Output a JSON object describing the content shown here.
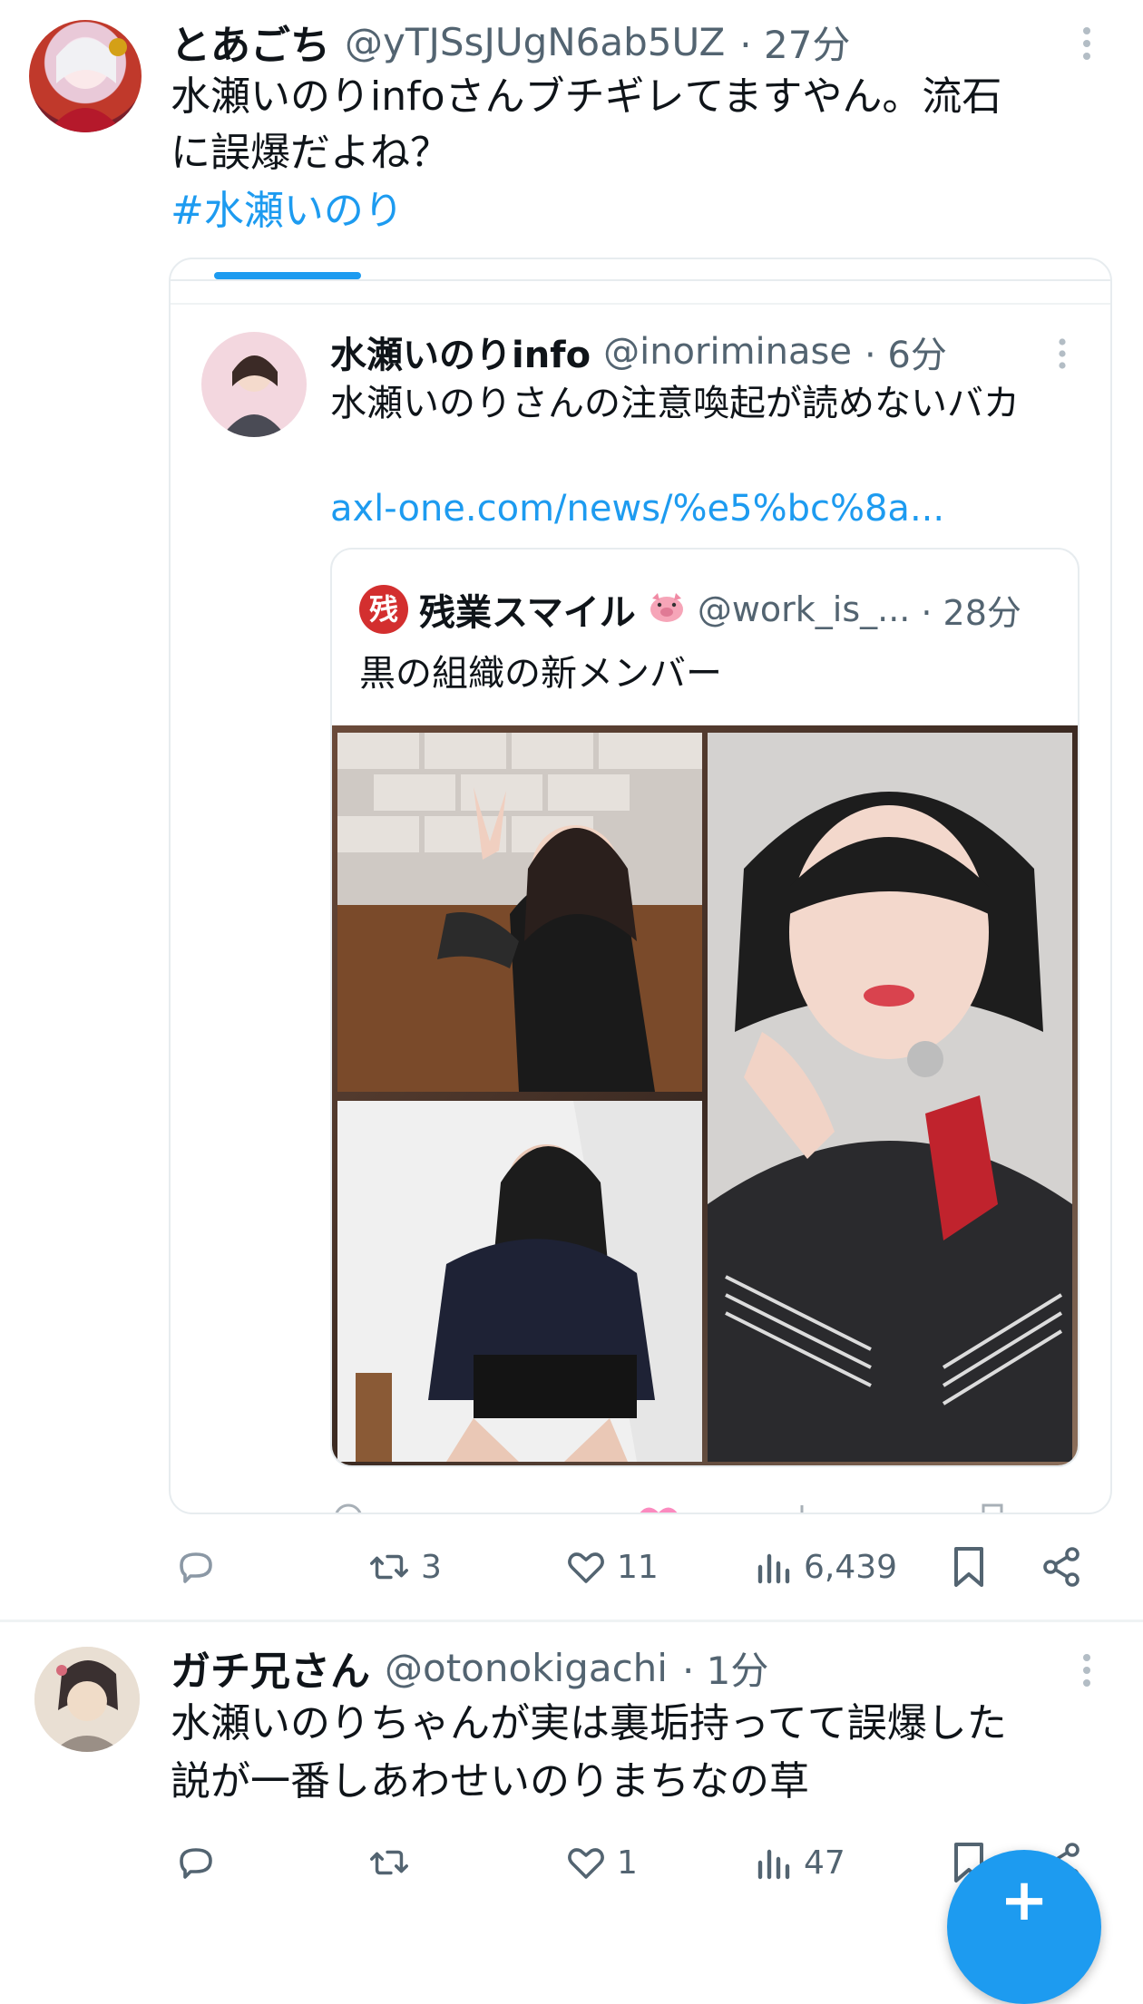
{
  "tweet1": {
    "display_name": "とあごち",
    "handle": "@yTJSsJUgN6ab5UZ",
    "time": "· 27分",
    "line1": "水瀬いのりinfoさんブチギレてますやん。流石",
    "line2": "に誤爆だよね？",
    "hashtag": "#水瀬いのり",
    "actions": {
      "retweets": "3",
      "likes": "11",
      "views": "6,439"
    }
  },
  "quoted": {
    "display_name": "水瀬いのりinfo",
    "handle": "@inoriminase",
    "time": "· 6分",
    "text": "水瀬いのりさんの注意喚起が読めないバカ",
    "url": "axl-one.com/news/%e5%bc%8a...",
    "inner": {
      "badge": "残",
      "display_name": "残業スマイル",
      "handle": "@work_is_...",
      "time": "· 28分",
      "text": "黒の組織の新メンバー"
    }
  },
  "tweet2": {
    "display_name": "ガチ兄さん",
    "handle": "@otonokigachi",
    "time": "· 1分",
    "line1": "水瀬いのりちゃんが実は裏垢持ってて誤爆した",
    "line2": "説が一番しあわせいのりまちなの草",
    "actions": {
      "likes": "1",
      "views": "47"
    }
  },
  "fab": {
    "label": "+"
  },
  "colors": {
    "accent": "#1d9bf0",
    "text": "#0f1419",
    "meta": "#536471",
    "border": "#cfd9de"
  }
}
